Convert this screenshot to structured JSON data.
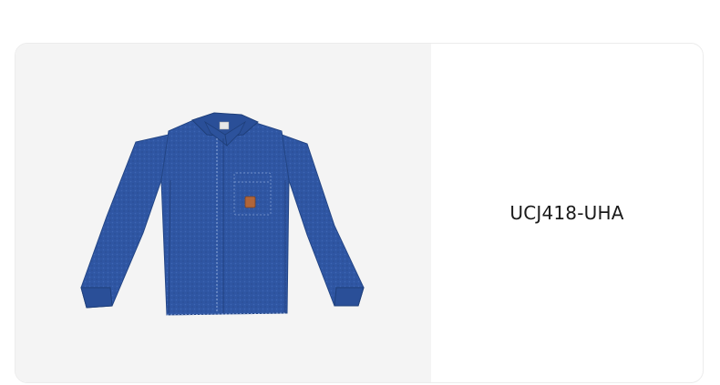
{
  "product": {
    "sku": "UCJ418-UHA",
    "image_icon": "denim-shirt",
    "colors": {
      "denim": "#2f56a3",
      "denim_dark": "#264a8e",
      "patch": "#b0653a",
      "panel_bg": "#f4f4f4"
    }
  }
}
